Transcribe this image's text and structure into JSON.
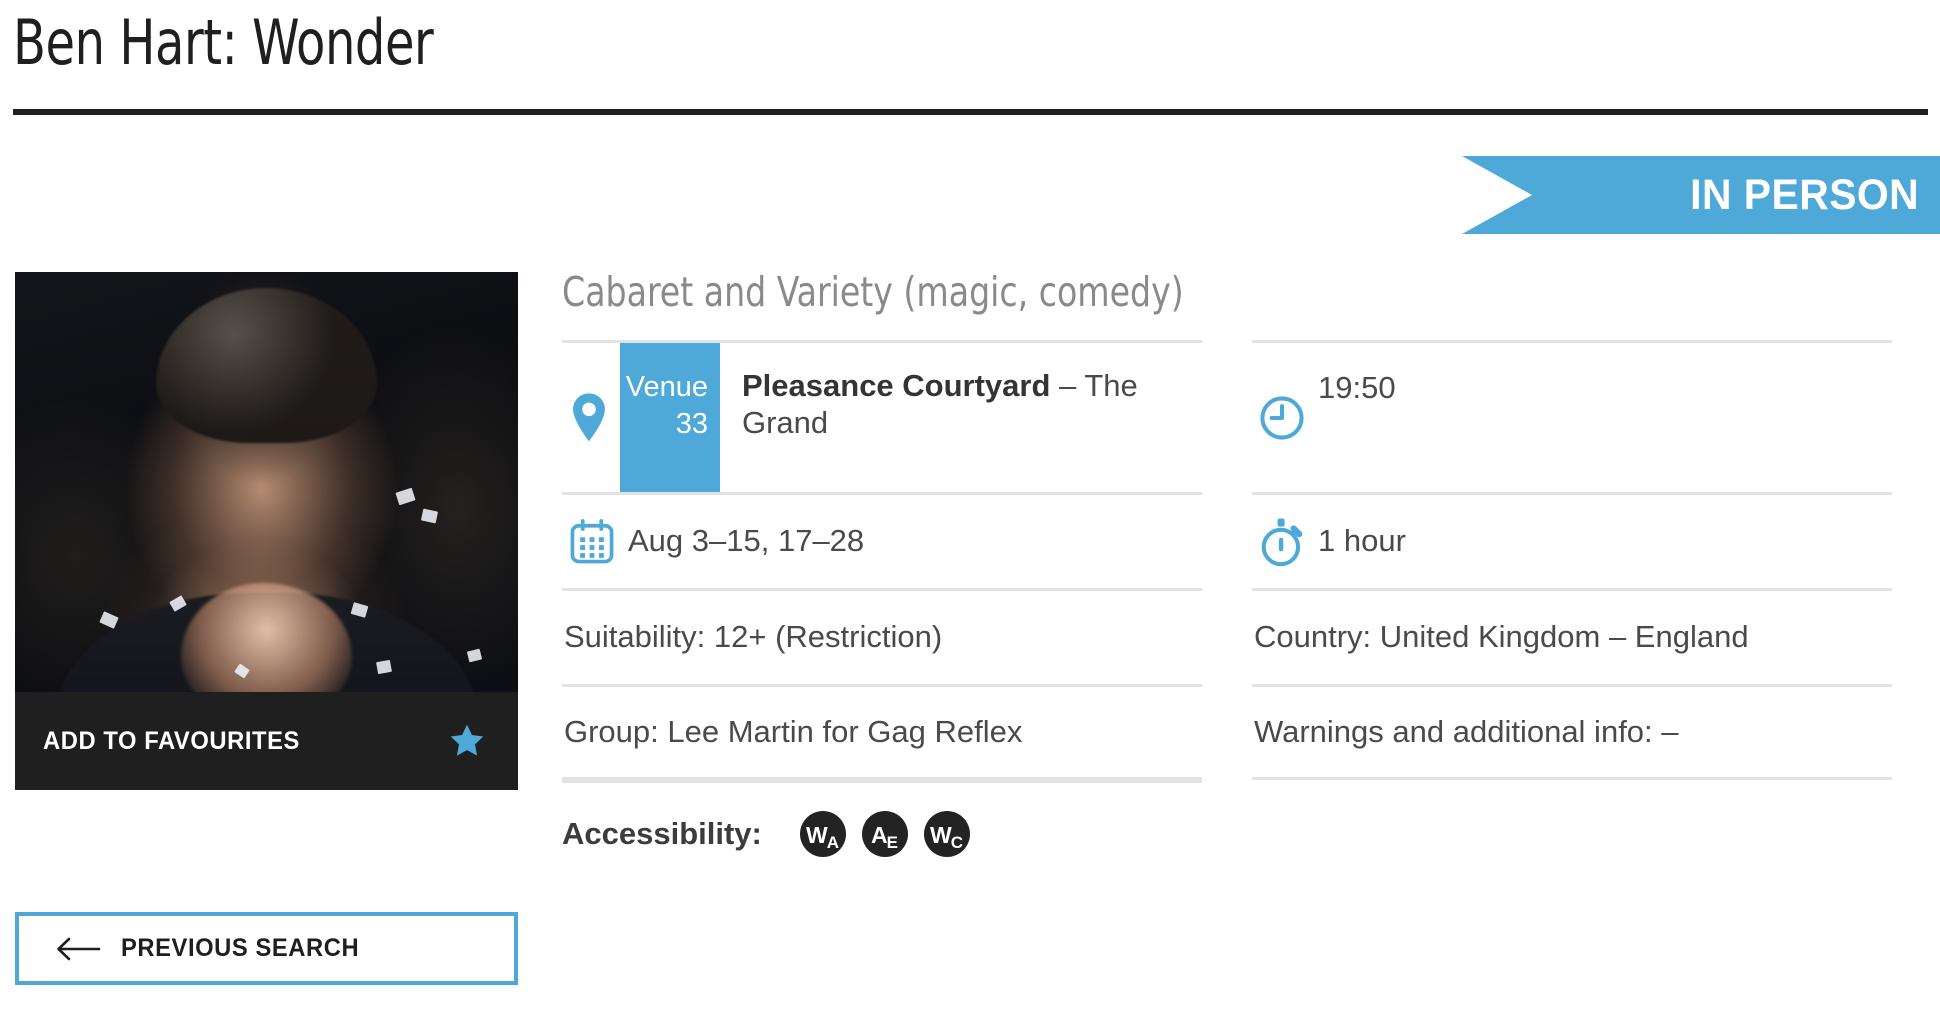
{
  "header": {
    "title": "Ben Hart: Wonder"
  },
  "ribbon": {
    "label": "IN PERSON"
  },
  "poster": {
    "favourites_label": "ADD TO FAVOURITES",
    "star_icon": "star-icon"
  },
  "previous_search": {
    "label": "PREVIOUS SEARCH",
    "arrow_icon": "arrow-left-icon"
  },
  "details": {
    "genre": "Cabaret and Variety (magic, comedy)",
    "venue": {
      "pin_icon": "map-pin-icon",
      "badge_line1": "Venue",
      "badge_line2": "33",
      "name_bold": "Pleasance Courtyard",
      "name_rest": " – The Grand"
    },
    "dates": {
      "calendar_icon": "calendar-icon",
      "value": "Aug 3–15, 17–28"
    },
    "time": {
      "clock_icon": "clock-icon",
      "value": "19:50"
    },
    "duration": {
      "stopwatch_icon": "stopwatch-icon",
      "value": "1 hour"
    },
    "suitability": "Suitability: 12+ (Restriction)",
    "country": "Country: United Kingdom – England",
    "group": "Group: Lee Martin for Gag Reflex",
    "warnings": "Warnings and additional info: –",
    "accessibility": {
      "label": "Accessibility:",
      "badges": [
        {
          "main": "W",
          "sub": "A"
        },
        {
          "main": "A",
          "sub": "E"
        },
        {
          "main": "W",
          "sub": "C"
        }
      ]
    }
  },
  "colors": {
    "accent_blue": "#4ea9d8",
    "dark": "#1f1f1f",
    "body_text": "#4a4a4a",
    "muted": "#8a8a8a",
    "divider": "#e3e3e3"
  }
}
